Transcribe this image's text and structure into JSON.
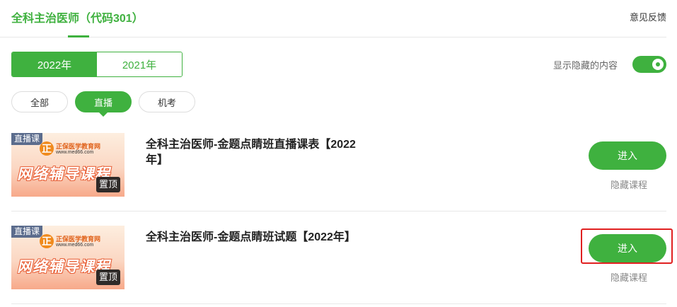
{
  "header": {
    "title": "全科主治医师（代码301）",
    "feedback_label": "意见反馈"
  },
  "year_tabs": [
    {
      "label": "2022年",
      "active": true
    },
    {
      "label": "2021年",
      "active": false
    }
  ],
  "show_hidden": {
    "label": "显示隐藏的内容",
    "enabled": true
  },
  "filters": [
    {
      "label": "全部",
      "active": false
    },
    {
      "label": "直播",
      "active": true
    },
    {
      "label": "机考",
      "active": false
    }
  ],
  "courses": [
    {
      "title": "全科主治医师-金题点睛班直播课表【2022年】",
      "thumb": {
        "badge": "直播课",
        "logo": "正",
        "brand": "正保医学教育网",
        "url": "www.med66.com",
        "slogan": "网络辅导课程",
        "pin": "置顶"
      },
      "enter_label": "进入",
      "hide_label": "隐藏课程"
    },
    {
      "title": "全科主治医师-金题点睛班试题【2022年】",
      "thumb": {
        "badge": "直播课",
        "logo": "正",
        "brand": "正保医学教育网",
        "url": "www.med66.com",
        "slogan": "网络辅导课程",
        "pin": "置顶"
      },
      "enter_label": "进入",
      "hide_label": "隐藏课程"
    }
  ],
  "colors": {
    "accent": "#3fb13f",
    "highlight": "#e02020"
  }
}
